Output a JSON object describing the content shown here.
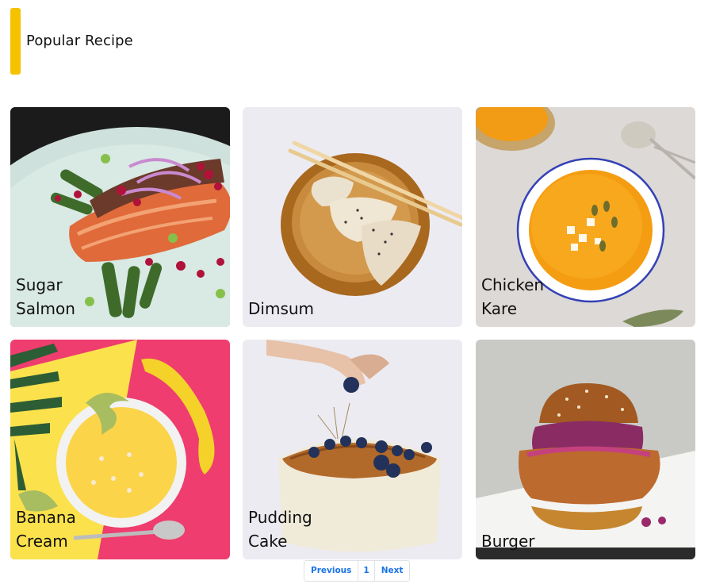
{
  "header": {
    "title": "Popular Recipe",
    "accent_color": "#f5c200"
  },
  "recipes": [
    {
      "line1": "Sugar",
      "line2": "Salmon",
      "image": "salmon-dish-image"
    },
    {
      "line1": "Dimsum",
      "line2": "",
      "image": "dumplings-plate-image"
    },
    {
      "line1": "Chicken",
      "line2": "Kare",
      "image": "curry-soup-bowl-image"
    },
    {
      "line1": "Banana",
      "line2": "Cream",
      "image": "banana-cream-bowl-image"
    },
    {
      "line1": "Pudding",
      "line2": "Cake",
      "image": "blueberry-cake-image"
    },
    {
      "line1": "Burger",
      "line2": "",
      "image": "chicken-burger-image"
    }
  ],
  "pagination": {
    "previous": "Previous",
    "page": "1",
    "next": "Next",
    "link_color": "#1a73e8"
  }
}
